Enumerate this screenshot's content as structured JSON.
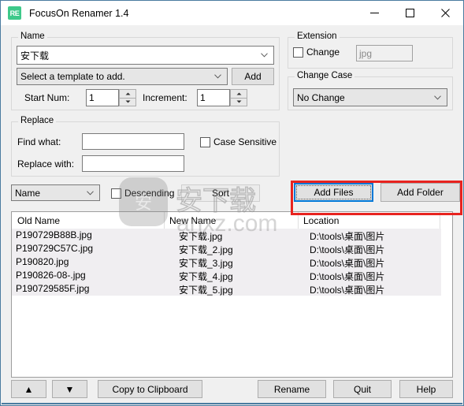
{
  "window": {
    "title": "FocusOn Renamer 1.4",
    "icon_label": "RE",
    "icon_name": "app-logo-icon",
    "accent_color": "#3ec98a",
    "border_color": "#4a7ba0",
    "controls": {
      "minimize": "minimize-icon",
      "maximize": "maximize-icon",
      "close": "close-icon"
    }
  },
  "name_group": {
    "title": "Name",
    "name_value": "安下载",
    "template_value": "Select a template to add.",
    "add_button": "Add",
    "start_num_label": "Start Num:",
    "start_num_value": "1",
    "increment_label": "Increment:",
    "increment_value": "1"
  },
  "extension_group": {
    "title": "Extension",
    "change_label": "Change",
    "change_checked": false,
    "ext_value": "jpg",
    "ext_disabled": true
  },
  "change_case_group": {
    "title": "Change Case",
    "value": "No Change"
  },
  "replace_group": {
    "title": "Replace",
    "find_label": "Find what:",
    "find_value": "",
    "replace_label": "Replace with:",
    "replace_value": "",
    "case_sensitive_label": "Case Sensitive",
    "case_sensitive_checked": false
  },
  "sort_row": {
    "sort_field": "Name",
    "descending_label": "Descending",
    "descending_checked": false,
    "sort_button": "Sort"
  },
  "add_buttons": {
    "add_files": "Add Files",
    "add_folder": "Add Folder",
    "add_files_focused": true,
    "highlight_color": "#e8231f"
  },
  "file_list": {
    "columns": [
      "Old Name",
      "New Name",
      "Location"
    ],
    "rows": [
      {
        "old_name": "P190729B88B.jpg",
        "new_name": "安下载.jpg",
        "location": "D:\\tools\\桌面\\图片"
      },
      {
        "old_name": "P190729C57C.jpg",
        "new_name": "安下载_2.jpg",
        "location": "D:\\tools\\桌面\\图片"
      },
      {
        "old_name": "P190820.jpg",
        "new_name": "安下载_3.jpg",
        "location": "D:\\tools\\桌面\\图片"
      },
      {
        "old_name": "P190826-08-.jpg",
        "new_name": "安下载_4.jpg",
        "location": "D:\\tools\\桌面\\图片"
      },
      {
        "old_name": "P190729585F.jpg",
        "new_name": "安下载_5.jpg",
        "location": "D:\\tools\\桌面\\图片"
      }
    ]
  },
  "bottom_bar": {
    "move_up": "▲",
    "move_down": "▼",
    "copy_to_clipboard": "Copy to Clipboard",
    "rename": "Rename",
    "quit": "Quit",
    "help": "Help"
  },
  "watermark": {
    "logo_glyph": "安",
    "text": "安下载",
    "domain": "anxz.com"
  }
}
